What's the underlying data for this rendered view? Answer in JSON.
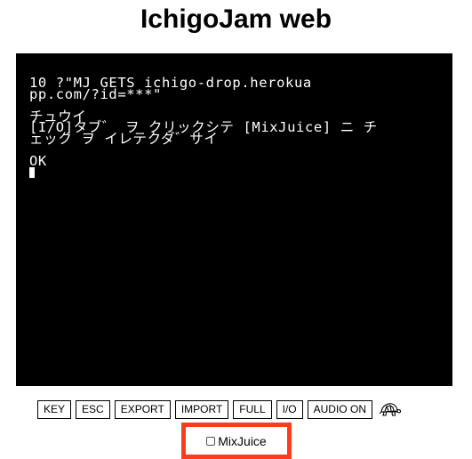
{
  "page": {
    "title": "IchigoJam web"
  },
  "screen": {
    "lines": [
      "10 ?\"MJ GETS ichigo-drop.herokua",
      "pp.com/?id=***\"",
      "",
      "チュウイ",
      "[I/O]タブ゛ ヲ クリックシテ [MixJuice] ニ チ",
      "ェック ヲ イレテクダ゛サイ",
      "",
      "OK"
    ],
    "colors": {
      "background": "#000000",
      "text": "#ffffff"
    }
  },
  "toolbar": {
    "buttons": [
      {
        "id": "key",
        "label": "KEY"
      },
      {
        "id": "esc",
        "label": "ESC"
      },
      {
        "id": "export",
        "label": "EXPORT"
      },
      {
        "id": "import",
        "label": "IMPORT"
      },
      {
        "id": "full",
        "label": "FULL"
      },
      {
        "id": "io",
        "label": "I/O"
      },
      {
        "id": "audio",
        "label": "AUDIO ON"
      }
    ],
    "turtle_icon": "turtle-icon"
  },
  "mixjuice": {
    "label": "MixJuice",
    "checked": false,
    "highlight_color": "#ff3b1e"
  }
}
